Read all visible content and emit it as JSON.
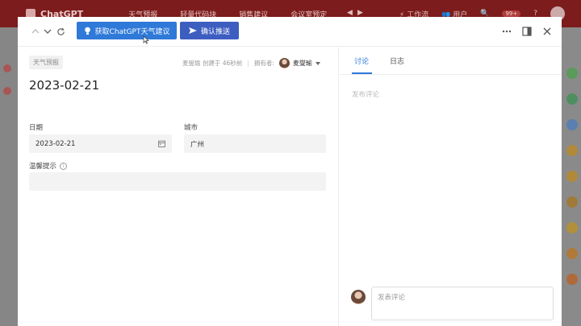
{
  "background": {
    "app_name": "ChatGPT",
    "nav_items": [
      "天气预报",
      "轻量代码块",
      "销售建议",
      "会议室预定"
    ],
    "workflow_label": "工作流",
    "users_label": "用户",
    "notification_count": "99+"
  },
  "toolbar": {
    "primary_button": "获取ChatGPT天气建议",
    "secondary_button": "确认推送"
  },
  "record": {
    "tag": "天气预报",
    "creator_info": "麦燮瑜 创建于 46秒前",
    "owner_label": "拥有者:",
    "owner_name": "麦燮瑜",
    "title": "2023-02-21",
    "fields": {
      "date_label": "日期",
      "date_value": "2023-02-21",
      "city_label": "城市",
      "city_value": "广州",
      "tip_label": "温馨提示",
      "tip_value": ""
    }
  },
  "side": {
    "tabs": [
      "讨论",
      "日志"
    ],
    "post_comment_placeholder": "发布评论",
    "comment_input_placeholder": "发表评论"
  },
  "colors": {
    "primary": "#2f79d9",
    "secondary": "#3d5ec0",
    "topbar": "#7d1c1c"
  }
}
